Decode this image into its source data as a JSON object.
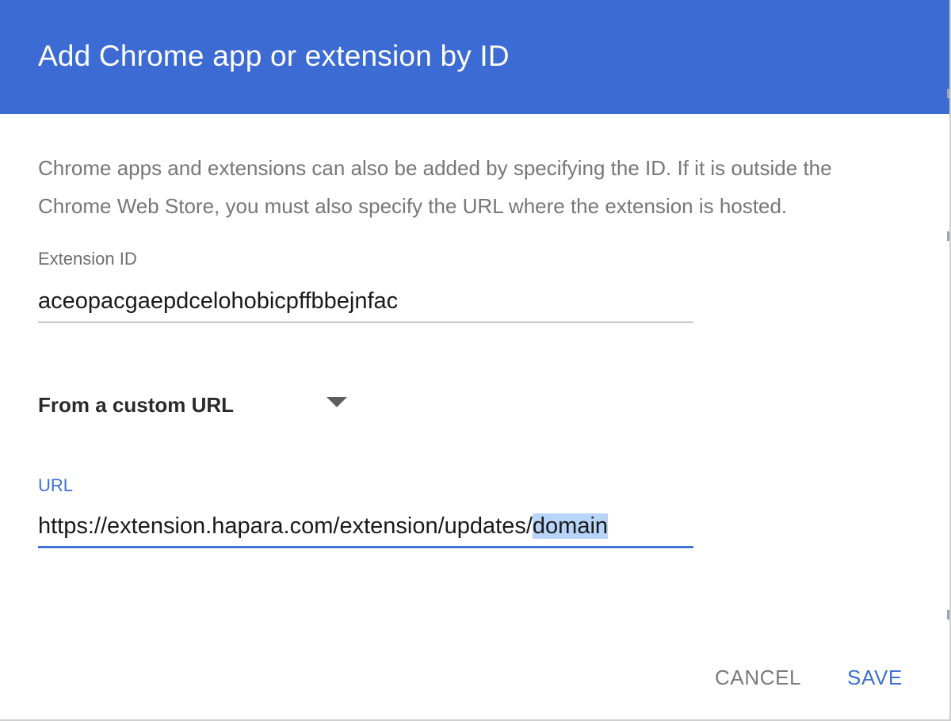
{
  "dialog": {
    "title": "Add Chrome app or extension by ID",
    "description": "Chrome apps and extensions can also be added by specifying the ID. If it is outside the Chrome Web Store, you must also specify the URL where the extension is hosted."
  },
  "extension_id_field": {
    "label": "Extension ID",
    "value": "aceopacgaepdcelohobicpffbbejnfac"
  },
  "source_select": {
    "selected": "From a custom URL",
    "icon": "dropdown-arrow-icon"
  },
  "url_field": {
    "label": "URL",
    "value_unselected": "https://extension.hapara.com/extension/updates/",
    "value_selected": "domain"
  },
  "actions": {
    "cancel_label": "CANCEL",
    "save_label": "SAVE"
  },
  "colors": {
    "header": "#3c6bd3",
    "accent": "#3f72d9",
    "selection": "#b8d4f8"
  }
}
